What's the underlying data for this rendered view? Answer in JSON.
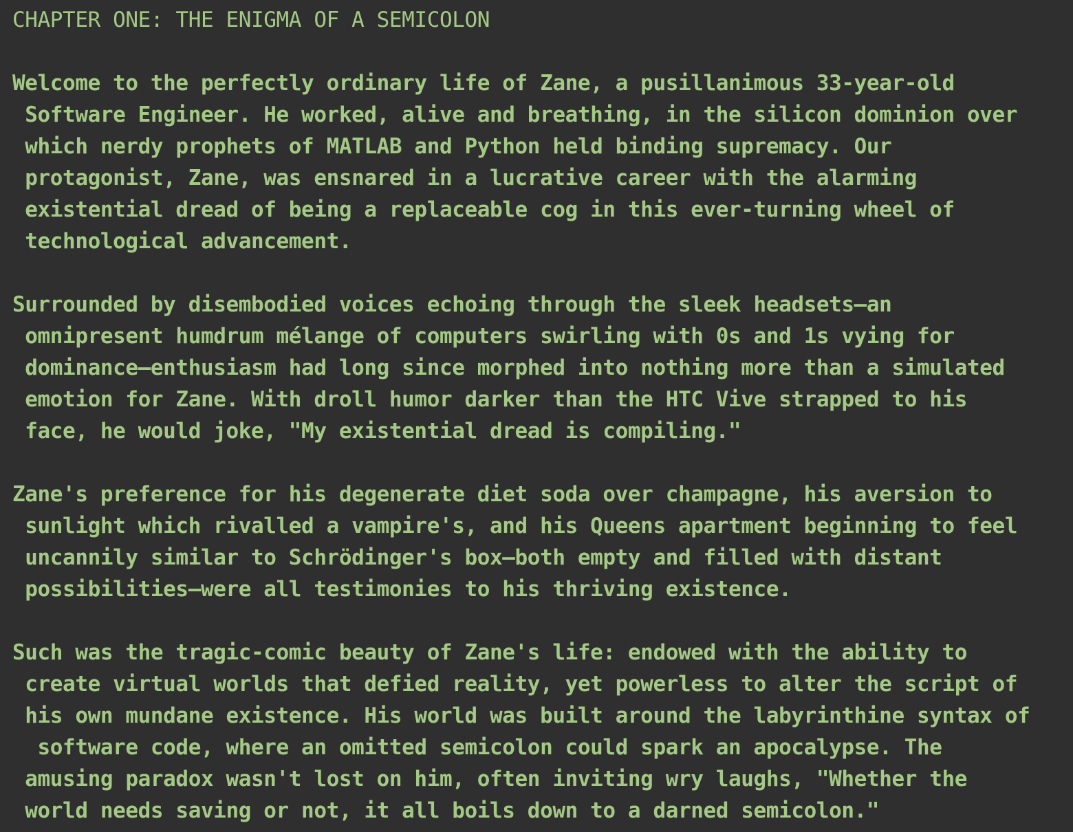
{
  "document": {
    "title": "CHAPTER ONE: THE ENIGMA OF A SEMICOLON",
    "paragraphs": [
      {
        "lines": [
          "Welcome to the perfectly ordinary life of Zane, a pusillanimous 33-year-old",
          " Software Engineer. He worked, alive and breathing, in the silicon dominion over",
          " which nerdy prophets of MATLAB and Python held binding supremacy. Our",
          " protagonist, Zane, was ensnared in a lucrative career with the alarming",
          " existential dread of being a replaceable cog in this ever-turning wheel of",
          " technological advancement."
        ]
      },
      {
        "lines": [
          "Surrounded by disembodied voices echoing through the sleek headsets—an",
          " omnipresent humdrum mélange of computers swirling with 0s and 1s vying for",
          " dominance—enthusiasm had long since morphed into nothing more than a simulated",
          " emotion for Zane. With droll humor darker than the HTC Vive strapped to his",
          " face, he would joke, \"My existential dread is compiling.\""
        ]
      },
      {
        "lines": [
          "Zane's preference for his degenerate diet soda over champagne, his aversion to",
          " sunlight which rivalled a vampire's, and his Queens apartment beginning to feel",
          " uncannily similar to Schrödinger's box—both empty and filled with distant",
          " possibilities—were all testimonies to his thriving existence."
        ]
      },
      {
        "lines": [
          "Such was the tragic-comic beauty of Zane's life: endowed with the ability to",
          " create virtual worlds that defied reality, yet powerless to alter the script of",
          " his own mundane existence. His world was built around the labyrinthine syntax of",
          "  software code, where an omitted semicolon could spark an apocalypse. The",
          " amusing paradox wasn't lost on him, often inviting wry laughs, \"Whether the",
          " world needs saving or not, it all boils down to a darned semicolon.\""
        ]
      }
    ]
  },
  "colors": {
    "background": "#2f2f2f",
    "text": "#a3c985"
  }
}
